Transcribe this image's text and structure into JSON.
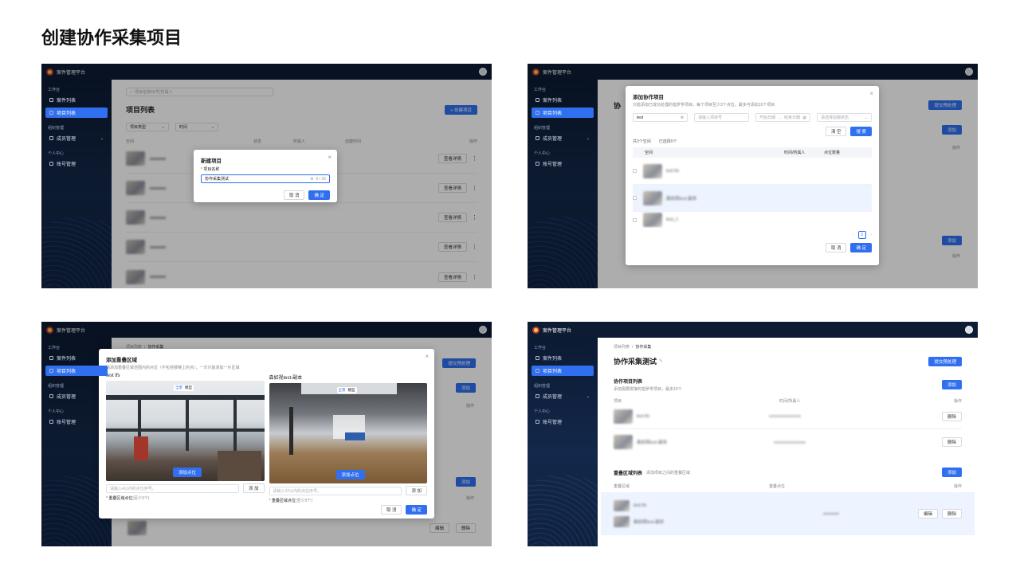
{
  "title": "创建协作采集项目",
  "app_name": "案件管理平台",
  "sidebar": {
    "sec_work": "工作台",
    "case_list": "案件列表",
    "project_list": "项目列表",
    "sec_org": "组织管理",
    "member_mgmt": "成员管理",
    "sec_personal": "个人中心",
    "account_mgmt": "账号管理"
  },
  "s1": {
    "search_placeholder": "项目名称/ID号/所属人",
    "list_title": "项目列表",
    "create_button": "+ 创建项目",
    "filter_type": "项目类型",
    "filter_time": "时间",
    "col_space": "空间",
    "col_status": "状态",
    "col_owner": "所属人",
    "col_created": "创建时间",
    "col_action": "操作",
    "view_detail": "查看详情",
    "modal": {
      "title": "新建项目",
      "label": "项目名称",
      "value": "协作采集测试",
      "count": "6 / 35",
      "cancel": "取 消",
      "ok": "确 定"
    }
  },
  "s2": {
    "modal": {
      "title": "添加协作项目",
      "desc": "只能添加已成功处理的指罗孚项目。每个项目至少3个点位。最多可添加10个项目",
      "search_value": "test",
      "owner_placeholder": "请输入项目号",
      "date_start": "开始日期",
      "date_end": "结束日期",
      "status_placeholder": "请选择拍摄状态",
      "reset": "清 空",
      "search": "搜 索",
      "count_text": "共3个空间",
      "selected_text": "已选择0个",
      "col_space": "空间",
      "col_time": "时间/所属人",
      "col_points": "点位数量",
      "rows": [
        {
          "name": "test tfs"
        },
        {
          "name": "森如视test-副本"
        },
        {
          "name": "test_1"
        }
      ],
      "page": "1",
      "cancel": "取 消",
      "ok": "确 定"
    },
    "bg_submit": "提交预处理",
    "bg_add": "添加",
    "bg_col_action": "操作",
    "bg_title": "协"
  },
  "s3": {
    "breadcrumb_root": "项目列表",
    "breadcrumb_sep": "/",
    "breadcrumb_current": "协作采集",
    "bg_submit": "提交预处理",
    "bg_add": "添加",
    "bg_col_action": "操作",
    "modal": {
      "title": "添加重叠区域",
      "desc": "请添加重叠区域范围内的点位（不包括楼梯上的点），一次只能添加一片区域",
      "left": {
        "name": "test tfs",
        "tab_pano": "全景",
        "tab_model": "模型",
        "add_point": "添加点位",
        "placeholder": "请输入4以内的点位序号。",
        "add": "添 加",
        "req_label": "重叠区域点位",
        "req_hint": "(至少3个)"
      },
      "right": {
        "name": "森如视test-副本",
        "tab_pano": "全景",
        "tab_model": "模型",
        "add_point": "添加点位",
        "placeholder": "请输入22以内的点位序号。",
        "add": "添 加",
        "req_label": "重叠区域点位",
        "req_hint": "(至少3个)"
      },
      "cancel": "取 消",
      "ok": "确 定"
    },
    "bg_edit": "编辑",
    "bg_delete": "删除"
  },
  "s4": {
    "breadcrumb_root": "项目列表",
    "breadcrumb_sep": "/",
    "breadcrumb_current": "协作采集",
    "project_name": "协作采集测试",
    "submit": "提交预处理",
    "collab_title": "协作项目列表",
    "collab_desc": "添加需要拼接的指罗孚项目，最多10个",
    "add": "添加",
    "col_project": "项目",
    "col_time": "时间/所属人",
    "col_action": "操作",
    "rows": [
      {
        "name": "test tfs",
        "delete": "删除"
      },
      {
        "name": "森如视test-副本",
        "delete": "删除"
      }
    ],
    "overlap_title": "重叠区域列表",
    "overlap_desc": "添加项目之间的重叠区域",
    "add2": "添加",
    "col_overlap": "重叠区域",
    "col_overlap_points": "重叠点位",
    "col_action2": "操作",
    "overlap_rows": [
      {
        "a": "test tfs",
        "b": "森如视test-副本",
        "edit": "编辑",
        "delete": "删除"
      }
    ]
  }
}
